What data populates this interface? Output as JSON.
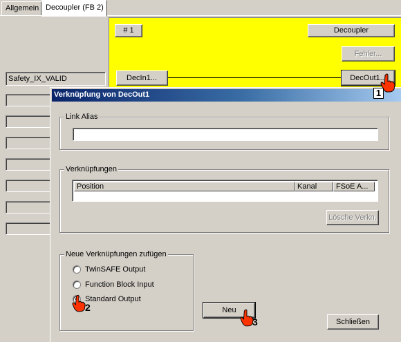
{
  "tabs": [
    {
      "label": "Allgemein",
      "active": false
    },
    {
      "label": "Decoupler (FB 2)",
      "active": true
    }
  ],
  "left_panel": {
    "field_value": "Safety_IX_VALID"
  },
  "block": {
    "id_label": "# 1",
    "name_label": "Decoupler",
    "error_button": "Fehler...",
    "input_button": "DecIn1...",
    "output_button": "DecOut1..."
  },
  "dialog": {
    "title": "Verknüpfung von DecOut1",
    "link_alias": {
      "label": "Link Alias",
      "value": ""
    },
    "links": {
      "label": "Verknüpfungen",
      "columns": [
        "Position",
        "Kanal",
        "FSoE A..."
      ],
      "rows": [],
      "delete_button": "Lösche Verkn."
    },
    "new_links": {
      "label": "Neue Verknüpfungen zufügen",
      "options": [
        {
          "label": "TwinSAFE Output",
          "checked": false
        },
        {
          "label": "Function Block Input",
          "checked": false
        },
        {
          "label": "Standard Output",
          "checked": true
        }
      ],
      "new_button": "Neu"
    },
    "close_button": "Schließen"
  },
  "callouts": [
    "1",
    "2",
    "3"
  ],
  "colors": {
    "block_background": "#ffff00",
    "titlebar_start": "#0a246a",
    "titlebar_end": "#a6caf0",
    "hand_fill": "#ff3300"
  }
}
